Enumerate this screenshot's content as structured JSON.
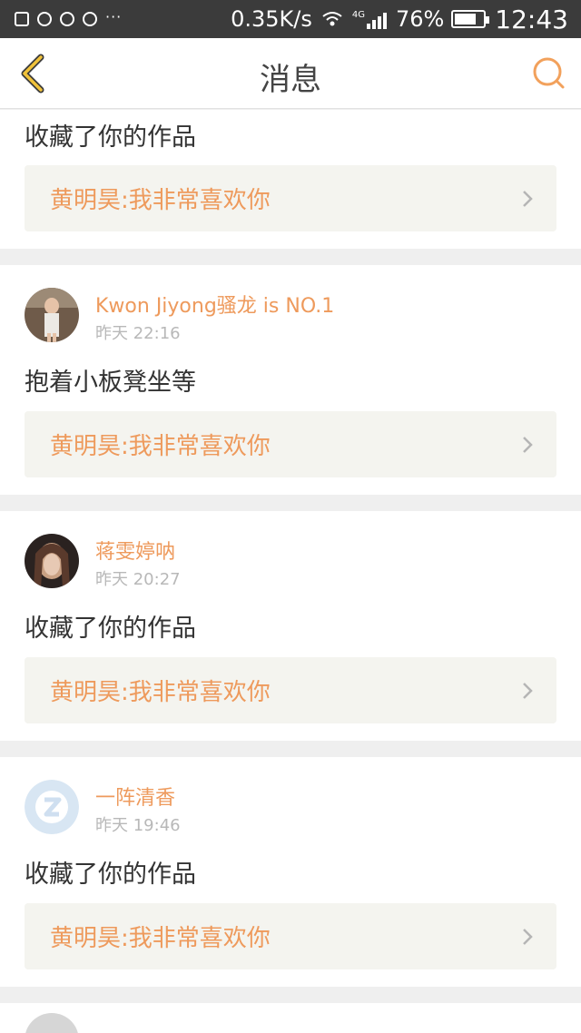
{
  "status_bar": {
    "speed": "0.35K/s",
    "network": "4G",
    "battery": "76%",
    "battery_level": 0.76,
    "time": "12:43",
    "more": "···"
  },
  "header": {
    "title": "消息",
    "back_icon": "chevron-left-icon",
    "search_icon": "search-icon"
  },
  "accent_color": "#ee9a5c",
  "messages": [
    {
      "action": "收藏了你的作品",
      "quote": "黄明昊:我非常喜欢你"
    },
    {
      "user": "Kwon Jiyong骚龙 is NO.1",
      "time": "昨天 22:16",
      "action": "抱着小板凳坐等",
      "quote": "黄明昊:我非常喜欢你"
    },
    {
      "user": "蒋雯婷呐",
      "time": "昨天 20:27",
      "action": "收藏了你的作品",
      "quote": "黄明昊:我非常喜欢你"
    },
    {
      "user": "一阵清香",
      "time": "昨天 19:46",
      "action": "收藏了你的作品",
      "quote": "黄明昊:我非常喜欢你"
    }
  ]
}
